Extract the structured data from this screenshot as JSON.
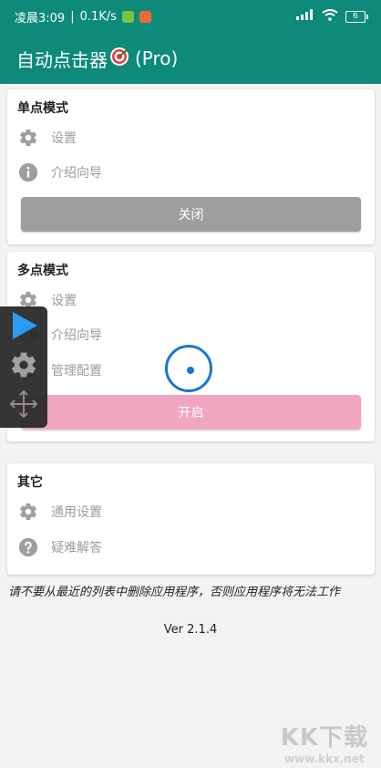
{
  "status_bar": {
    "time": "凌晨3:09",
    "network_speed": "0.1K/s",
    "separator": "|",
    "battery_level": "6",
    "icons": [
      "green-app-icon",
      "orange-app-icon",
      "signal-icon",
      "wifi-icon",
      "battery-icon"
    ]
  },
  "app_bar": {
    "title_main": "自动点击器",
    "title_icon": "dartboard-icon",
    "title_suffix": "(Pro)"
  },
  "single_mode": {
    "title": "单点模式",
    "items": [
      {
        "icon": "gear-icon",
        "label": "设置"
      },
      {
        "icon": "info-icon",
        "label": "介绍向导"
      }
    ],
    "button_label": "关闭",
    "button_color": "#9e9e9e"
  },
  "multi_mode": {
    "title": "多点模式",
    "items": [
      {
        "icon": "gear-icon",
        "label": "设置"
      },
      {
        "icon": "info-icon",
        "label": "介绍向导"
      },
      {
        "icon": "list-icon",
        "label": "管理配置"
      }
    ],
    "button_label": "开启",
    "button_color": "#f0a6c0"
  },
  "other": {
    "title": "其它",
    "items": [
      {
        "icon": "gear-icon",
        "label": "通用设置"
      },
      {
        "icon": "help-icon",
        "label": "疑难解答"
      }
    ]
  },
  "footer": {
    "note": "请不要从最近的列表中删除应用程序，否则应用程序将无法工作",
    "version": "Ver 2.1.4"
  },
  "floating_toolbar": {
    "buttons": [
      "play-icon",
      "gear-icon",
      "move-icon"
    ],
    "play_color": "#2196f3"
  },
  "watermark": {
    "logo": "KK下载",
    "url": "www.kkx.net"
  },
  "colors": {
    "primary": "#0d8a7a",
    "target": "#1976d2"
  }
}
